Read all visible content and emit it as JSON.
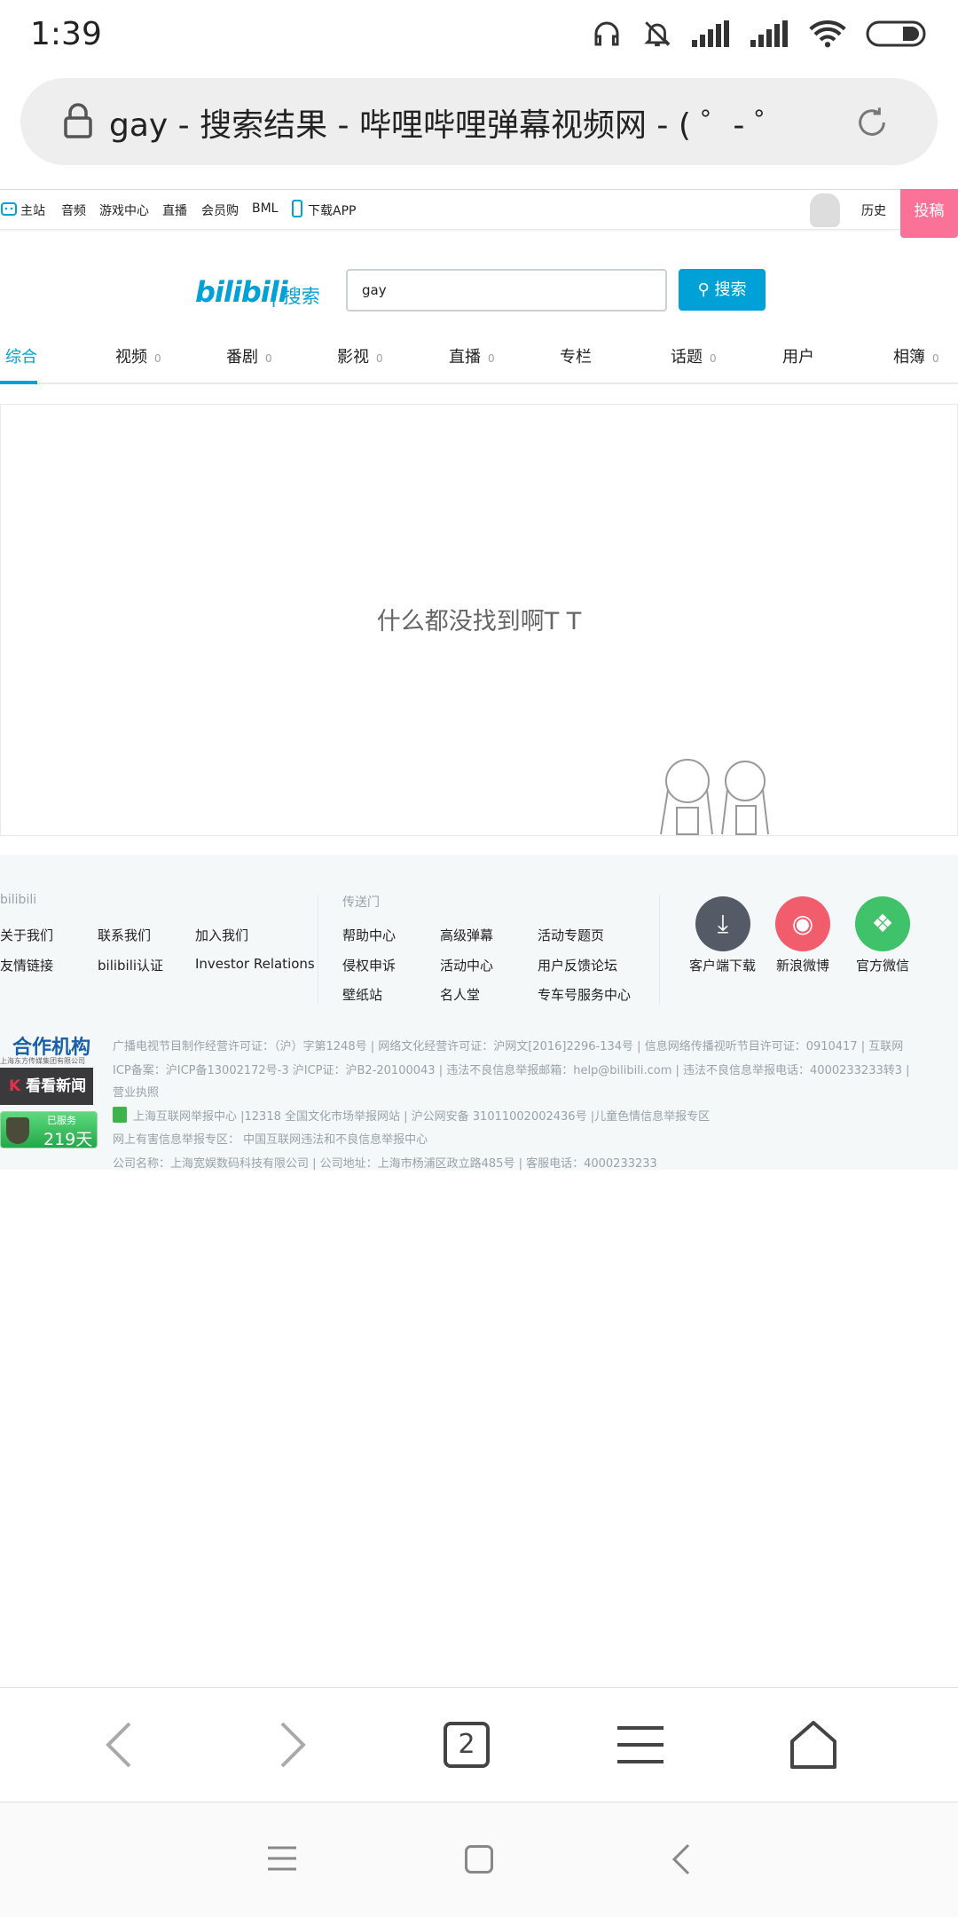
{
  "status_bar": {
    "time": "1:39"
  },
  "browser": {
    "url_title": "gay - 搜索结果 - 哔哩哔哩弹幕视频网 - ( ゜- ゜",
    "tab_count": "2"
  },
  "topnav": {
    "items": [
      "主站",
      "音频",
      "游戏中心",
      "直播",
      "会员购",
      "BML",
      "下载APP"
    ],
    "history": "历史",
    "post": "投稿"
  },
  "search": {
    "logo": "bilibili",
    "logo_sub": "| 搜索",
    "query": "gay",
    "button": "搜索"
  },
  "tabs": [
    {
      "label": "综合",
      "count": ""
    },
    {
      "label": "视频",
      "count": "0"
    },
    {
      "label": "番剧",
      "count": "0"
    },
    {
      "label": "影视",
      "count": "0"
    },
    {
      "label": "直播",
      "count": "0"
    },
    {
      "label": "专栏",
      "count": ""
    },
    {
      "label": "话题",
      "count": "0"
    },
    {
      "label": "用户",
      "count": ""
    },
    {
      "label": "相簿",
      "count": "0"
    }
  ],
  "empty_message": "什么都没找到啊T T",
  "footer": {
    "col1_title": "bilibili",
    "col1_links": [
      "关于我们",
      "联系我们",
      "加入我们",
      "友情链接",
      "bilibili认证",
      "Investor Relations"
    ],
    "col2_title": "传送门",
    "col2_links": [
      "帮助中心",
      "高级弹幕",
      "活动专题页",
      "侵权申诉",
      "活动中心",
      "用户反馈论坛",
      "壁纸站",
      "名人堂",
      "专车号服务中心"
    ],
    "apps": [
      "客户端下载",
      "新浪微博",
      "官方微信"
    ],
    "partner_title": "合作机构",
    "partner_sub": "上海东方传媒集团有限公司",
    "kankan": "看看新闻",
    "served_label": "已服务",
    "served_days": "219天",
    "license_lines": [
      "广播电视节目制作经营许可证：（沪）字第1248号 | 网络文化经营许可证：沪网文[2016]2296-134号 | 信息网络传播视听节目许可证：0910417 | 互联网",
      "ICP备案：沪ICP备13002172号-3 沪ICP证：沪B2-20100043 | 违法不良信息举报邮箱：help@bilibili.com | 违法不良信息举报电话：4000233233转3 |",
      "营业执照",
      "上海互联网举报中心 |12318 全国文化市场举报网站 | 沪公网安备 31011002002436号 |儿童色情信息举报专区",
      "网上有害信息举报专区： 中国互联网违法和不良信息举报中心",
      "公司名称：上海宽娱数码科技有限公司 | 公司地址：上海市杨浦区政立路485号 | 客服电话：4000233233"
    ]
  },
  "colors": {
    "accent": "#00a1d6",
    "pink": "#fb7299"
  }
}
